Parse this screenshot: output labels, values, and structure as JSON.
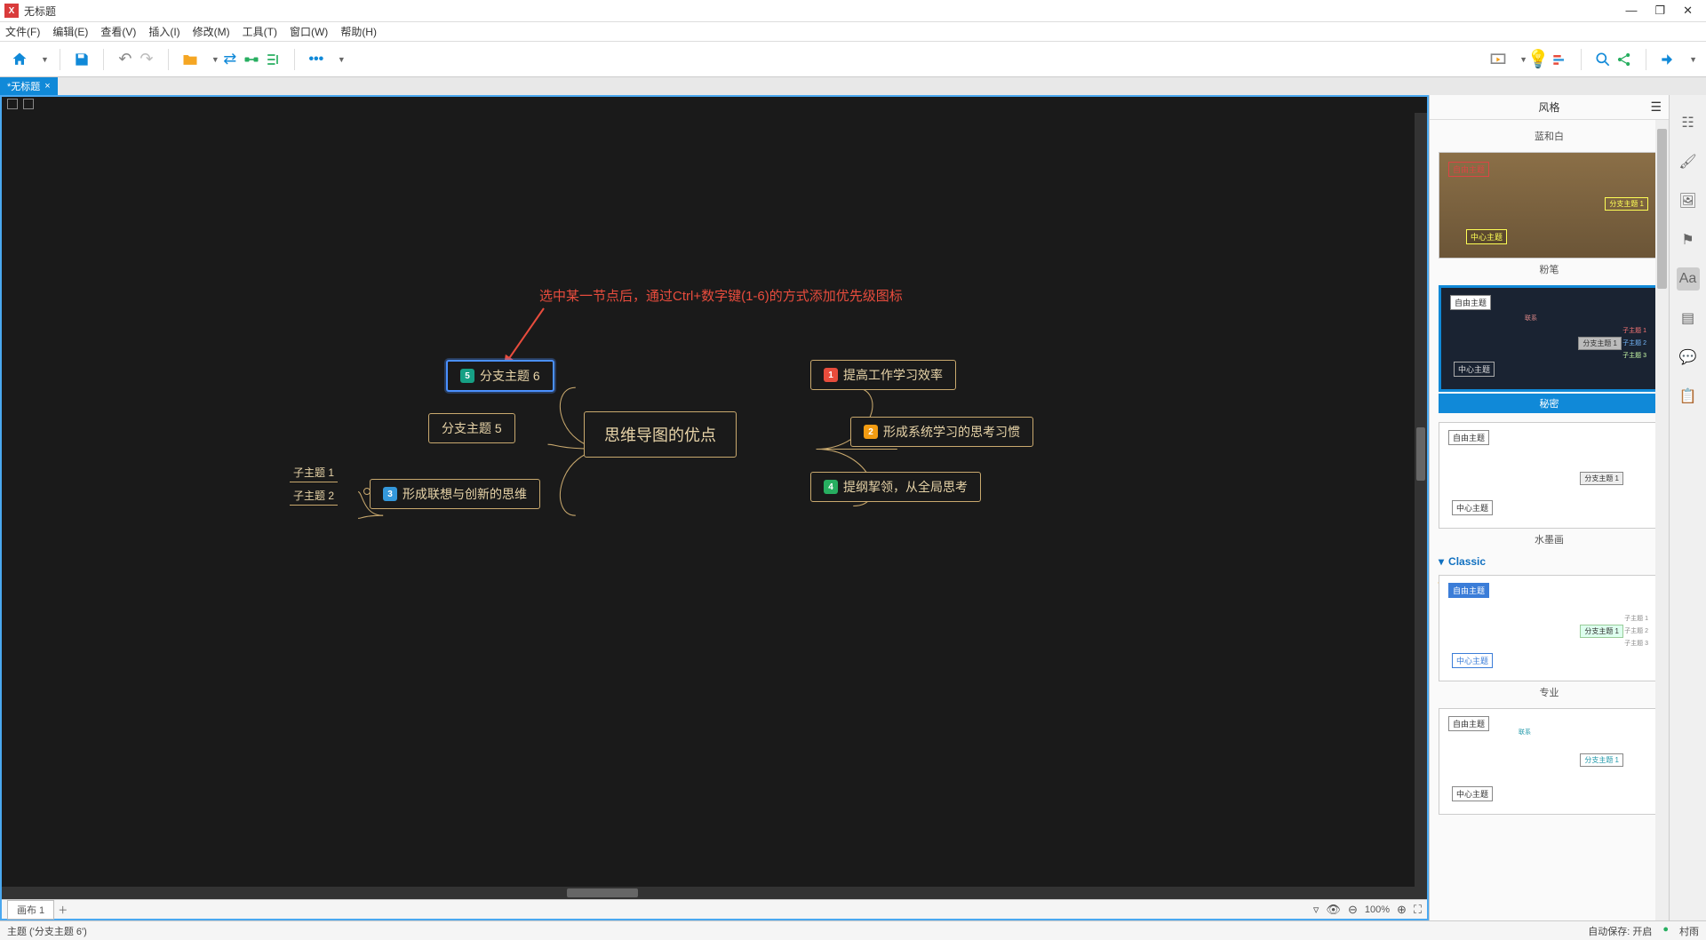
{
  "window": {
    "title": "无标题"
  },
  "menu": {
    "file": "文件(F)",
    "edit": "编辑(E)",
    "view": "查看(V)",
    "insert": "插入(I)",
    "modify": "修改(M)",
    "tools": "工具(T)",
    "window": "窗口(W)",
    "help": "帮助(H)"
  },
  "tab": {
    "label": "*无标题",
    "close": "×"
  },
  "annotation": {
    "text": "选中某一节点后，通过Ctrl+数字键(1-6)的方式添加优先级图标"
  },
  "mindmap": {
    "center": "思维导图的优点",
    "r1": {
      "badge": "1",
      "label": "提高工作学习效率"
    },
    "r2": {
      "badge": "2",
      "label": "形成系统学习的思考习惯"
    },
    "r3": {
      "badge": "4",
      "label": "提纲挈领，从全局思考"
    },
    "l1": {
      "badge": "5",
      "label": "分支主题 6"
    },
    "l2": {
      "label": "分支主题 5"
    },
    "l3": {
      "badge": "3",
      "label": "形成联想与创新的思维"
    },
    "sub1": "子主题 1",
    "sub2": "子主题 2"
  },
  "sheet": {
    "name": "画布 1",
    "zoom": "100%"
  },
  "panel": {
    "title": "风格",
    "style0": "蓝和白",
    "style1": "粉笔",
    "style2": "秘密",
    "style3": "水墨画",
    "category": "Classic",
    "style4": "专业",
    "thumb_center": "中心主题",
    "thumb_free": "自由主题",
    "thumb_branch": "分支主题 1",
    "thumb_sub1": "子主题 1",
    "thumb_sub2": "子主题 2",
    "thumb_sub3": "子主题 3",
    "thumb_link": "联系"
  },
  "status": {
    "left": "主题 ('分支主题 6')",
    "autosave": "自动保存: 开启",
    "user": "村雨"
  }
}
